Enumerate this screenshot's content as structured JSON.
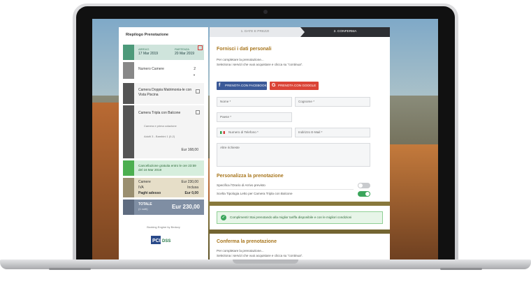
{
  "summary": {
    "title": "Riepilogo Prenotazione",
    "arrive_label": "ARRIVO",
    "arrive_date": "17 Mar 2019",
    "depart_label": "PARTENZA",
    "depart_date": "20 Mar 2019",
    "rooms_label": "Numero Camere",
    "rooms_value": "2",
    "room1_name": "Camera Doppia Matrimonia-le con Vista Piscina",
    "room2_name": "Camera Tripla con Balcone",
    "room2_detail1": "Camera e prima colazione",
    "room2_detail2": "Adulti 3 - Bambini 1 (0-2)",
    "room2_price": "Eur 168,00",
    "cancel_text": "Cancellazione gratuita entro le ore 23:59 del 16 Mar 2019",
    "totals": [
      {
        "label": "Camere",
        "value": "Eur 230,00"
      },
      {
        "label": "IVA",
        "value": "Inclusa"
      },
      {
        "label": "Paghi adesso",
        "value": "Eur 0,00"
      }
    ],
    "grand_label": "TOTALE",
    "grand_sub": "(1 notti)",
    "grand_value": "Eur 230,00",
    "powered_by": "Booking Engine by Bedzzy",
    "pci_text": "DSS"
  },
  "steps": {
    "step1": "1. DATE E PREZZI",
    "step2": "2. CONFERMA"
  },
  "form": {
    "title": "Fornisci i dati personali",
    "intro1": "Per completare la prenotazione...",
    "intro2": "Seleziona i servizi che vuoi acquistare e clicca su \"continua\".",
    "facebook_btn": "PRENOTA CON FACEBOOK",
    "google_btn": "PRENOTA CON GOOGLE",
    "fields": {
      "nome": "Nome *",
      "cognome": "Cognome *",
      "paese": "Paese *",
      "telefono": "Numero di Telefono *",
      "email": "Indirizzo E-Mail *",
      "richieste": "Altre richieste"
    },
    "personalize_title": "Personalizza la prenotazione",
    "option1": "Specifica l'Orario di Arrivo previsto",
    "option2": "Scelta Tipologia Letto per Camera Tripla con Balcone"
  },
  "success": {
    "text": "Complimenti! Stai prenotando alla miglior tariffa disponibile e con le migliori condizioni"
  },
  "confirm": {
    "title": "Conferma la prenotazione",
    "intro1": "Per completare la prenotazione...",
    "intro2": "Seleziona i servizi che vuoi acquistare e clicca su \"continua\"."
  },
  "colors": {
    "accent_gold": "#a8761d",
    "dates_green": "#4d9a7a",
    "facebook": "#3b5998",
    "google": "#db4437",
    "toggle_on": "#3aa55b",
    "step_active": "#2d2f33"
  },
  "icons": {
    "edit": "edit-icon",
    "check": "check-icon",
    "heart": "heart-icon",
    "cart": "cart-icon"
  }
}
